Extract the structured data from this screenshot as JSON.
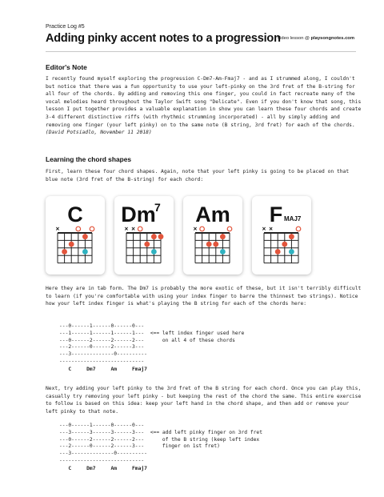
{
  "header": {
    "kicker": "Practice Log #5",
    "title": "Adding pinky accent notes to a progression",
    "video_prefix": "Video lesson @ ",
    "video_site": "playsongnotes.com"
  },
  "editors_note": {
    "heading": "Editor's Note",
    "body": "I recently found myself exploring the progression C-Dm7-Am-Fmaj7 - and as I strummed along, I couldn't but notice that there was a fun opportunity to use your left-pinky on the 3rd fret of the B-string for all four of the chords. By adding and removing this one finger, you could in fact recreate many of the vocal melodies heard throughout the Taylor Swift song \"Delicate\". Even if you don't know that song, this lesson I put together provides a valuable explanation in show you can learn these four chords and create 3-4 different distinctive riffs (with rhythmic strumming incorporated) - all by simply adding and removing one finger (your left pinky) on to the same note (B string, 3rd fret) for each of the chords.",
    "signature": "(David Potsiadlo, November 11 2018)"
  },
  "section": {
    "heading": "Learning the chord shapes",
    "intro": "First, learn these four chord shapes. Again, note that your left pinky is going to be placed on that blue note (3rd fret of the B-string) for each chord:",
    "chords": [
      {
        "name": "C",
        "sup": "",
        "sub": ""
      },
      {
        "name": "Dm",
        "sup": "7",
        "sub": ""
      },
      {
        "name": "Am",
        "sup": "",
        "sub": ""
      },
      {
        "name": "F",
        "sup": "",
        "sub": "MAJ7"
      }
    ],
    "tab_intro": "Here they are in tab form. The Dm7 is probably the more exotic of these, but it isn't terribly difficult to learn (if you're comfortable with using your index finger to barre the thinnest two strings). Notice how your left index finger is what's playing the B string for each of the chords here:",
    "tab1": "---0------1------0------0---\n---1------1------1------1---  <== left index finger used here\n---0------2------2------2---      on all 4 of these chords\n---2------0------2------3---\n---3--------------0----------\n----------------------------",
    "tab_labels": "   C     Dm7     Am     Fmaj7",
    "next_text": "Next, try adding your left pinky to the 3rd fret of the B string for each chord. Once you can play this, casually try removing your left pinky - but keeping the rest of the chord the same. This entire exercise to follow is based on this idea: keep your left hand in the chord shape, and then add or remove your left pinky to that note.",
    "tab2": "---0------1------0------0---\n---3------3------3------3---  <== add left pinky finger on 3rd fret\n---0------2------2------2---      of the B string (keep left index\n---2------0------2------3---      finger on 1st fret)\n---3--------------0----------\n----------------------------",
    "tab2_labels": "   C     Dm7     Am     Fmaj7"
  },
  "colors": {
    "red_dot": "#e2553c",
    "blue_dot": "#2fb2c0",
    "open_circle": "#e2553c",
    "grid": "#222222"
  }
}
